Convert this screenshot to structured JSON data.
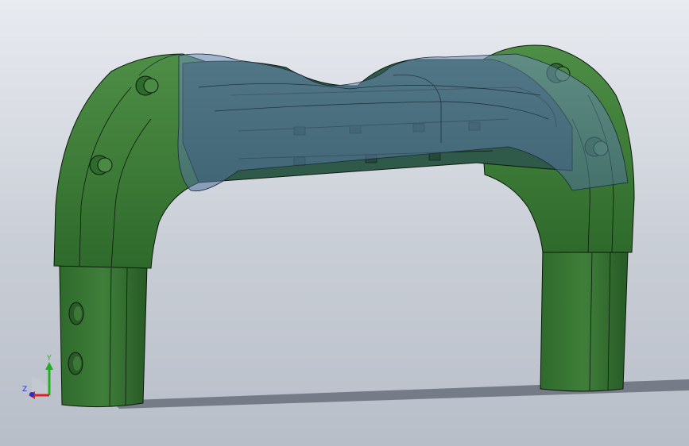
{
  "viewport": {
    "background_top": "#e8ebf0",
    "background_bottom": "#b8bec8"
  },
  "model": {
    "body_color": "#3f7a3a",
    "body_dark": "#2c5a2a",
    "body_light": "#4f8f48",
    "transparent_color": "#5a7fa8",
    "edge_color": "#0b1a0b",
    "shadow_color": "#6e7480"
  },
  "triad": {
    "y_label": "Y",
    "z_label": "Z",
    "x_color": "#e02020",
    "y_color": "#20b020",
    "z_color": "#2030d0"
  }
}
